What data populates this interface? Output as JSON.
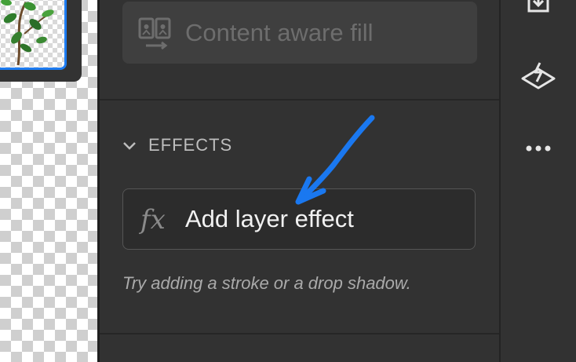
{
  "panel": {
    "content_aware_fill": {
      "label": "Content aware fill",
      "icon": "content-aware-fill-icon"
    },
    "effects": {
      "section_title": "EFFECTS",
      "add_effect_label": "Add layer effect",
      "fx_glyph": "fx",
      "hint": "Try adding a stroke or a drop shadow."
    }
  },
  "toolbar": {
    "icons": [
      "export-icon",
      "layer-effect-icon",
      "more-icon"
    ]
  },
  "colors": {
    "accent": "#1d7cf2",
    "panel_bg": "#323232",
    "button_bg": "#3f3f3f",
    "annotation": "#1a78f0"
  }
}
